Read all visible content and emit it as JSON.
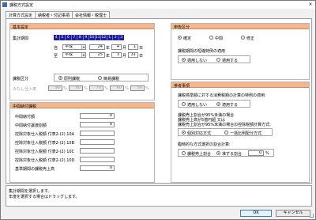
{
  "window": {
    "title": "課税方式設定",
    "close": "×"
  },
  "tabs": [
    {
      "label": "計算方式設定"
    },
    {
      "label": "納税者・付記事項"
    },
    {
      "label": "会社情報・税理士"
    }
  ],
  "basic": {
    "header": "基本設定",
    "period_label": "集計期間",
    "months": [
      "4",
      "5",
      "6",
      "7",
      "8",
      "9",
      "10",
      "11",
      "12",
      "1",
      "2",
      "3"
    ],
    "from_label": "自",
    "to_label": "至",
    "from": {
      "era": "平成",
      "year": "24",
      "year_unit": "年",
      "month": "4",
      "month_unit": "月",
      "day": "1",
      "day_unit": "日"
    },
    "to": {
      "era": "平成",
      "year": "25",
      "year_unit": "年",
      "month": "3",
      "month_unit": "月",
      "day": "31",
      "day_unit": "日"
    },
    "tax_class_label": "課税区分",
    "tax_class_options": [
      "原則課税",
      "簡易課税"
    ],
    "deemed_rate_label": "みなし仕入率",
    "deemed_rates": [
      "90",
      "80",
      "70",
      "60",
      "50"
    ],
    "percent": "%"
  },
  "midterm": {
    "header": "中間納付課税",
    "rows": [
      {
        "label": "中間納付額",
        "value": "0"
      },
      {
        "label": "中間納付譲渡割額",
        "value": "0"
      },
      {
        "label": "控除対象仕入税額 付表2-(2) 10A",
        "value": ""
      },
      {
        "label": "控除対象仕入税額 付表2-(2) 10B",
        "value": ""
      },
      {
        "label": "控除対象仕入税額 付表2-(2) 10C",
        "value": ""
      },
      {
        "label": "控除対象仕入税額 付表2-(2) 10D",
        "value": ""
      },
      {
        "label": "基準期間の課税売上高",
        "value": "0"
      }
    ]
  },
  "declaration": {
    "header": "申告区分",
    "options": [
      "確定",
      "中間",
      "修正"
    ],
    "special_label": "課税期間の短縮特例の適用",
    "special_options": [
      "適用しない",
      "適用する"
    ]
  },
  "reference": {
    "header": "参考事項",
    "q1": "課税標準額に対する消費税額の計算の特例の適用:",
    "q1_options": [
      "適用しない",
      "適用する"
    ],
    "q2_line1": "課税売上割合が95%未満の場合",
    "q2_line2": "課税売上高が5億円超 又は",
    "q2_line3": "課税売上割合が95%未満の場合の控除税額計算方式:",
    "q2_options": [
      "個別対応方式",
      "一括比例配分方式"
    ],
    "q3": "臨時的な方式選択の割合計算:",
    "q3_options": [
      "課税売上割合",
      "准ずる割合"
    ],
    "q3_value": "0",
    "percent": "%"
  },
  "message": {
    "line1": "集計期間を選択します。",
    "line2": "年度を選択する場合はドラッグします。"
  },
  "buttons": {
    "ok": "OK",
    "cancel": "キャンセル"
  }
}
